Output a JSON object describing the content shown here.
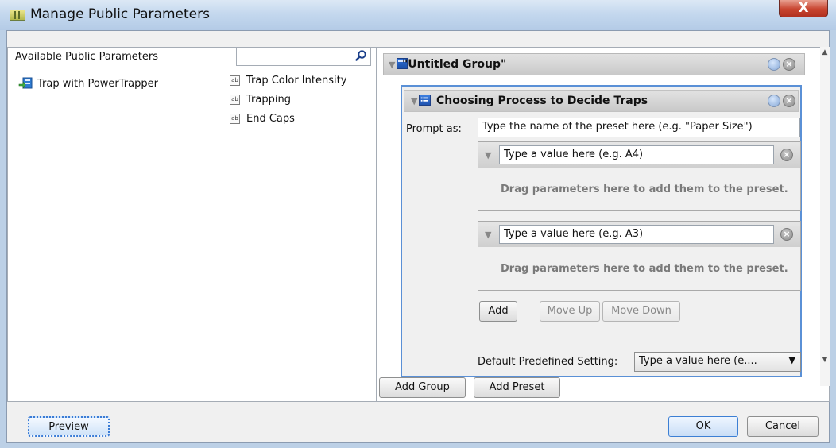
{
  "window": {
    "title": "Manage Public Parameters",
    "close_label": "X"
  },
  "left_panel": {
    "header": "Available Public Parameters",
    "search": {
      "value": "",
      "placeholder": ""
    },
    "templates": [
      {
        "label": "Trap with PowerTrapper"
      }
    ],
    "parameters": [
      {
        "label": "Trap Color Intensity"
      },
      {
        "label": "Trapping"
      },
      {
        "label": "End Caps"
      }
    ]
  },
  "group": {
    "title": "\"Untitled Group\"",
    "preset": {
      "title": "Choosing Process to Decide Traps",
      "prompt_label": "Prompt as:",
      "prompt_value": "Type the name of the preset here (e.g. \"Paper Size\")",
      "values": [
        {
          "input": "Type a value here (e.g. A4)",
          "hint": "Drag parameters here to add them to the preset."
        },
        {
          "input": "Type a value here (e.g. A3)",
          "hint": "Drag parameters here to add them to the preset."
        }
      ],
      "buttons": {
        "add": "Add",
        "move_up": "Move Up",
        "move_down": "Move Down"
      },
      "default_label": "Default Predefined Setting:",
      "default_value": "Type a value here (e...."
    }
  },
  "bottom_buttons": {
    "add_group": "Add Group",
    "add_preset": "Add Preset"
  },
  "footer": {
    "preview": "Preview",
    "ok": "OK",
    "cancel": "Cancel"
  },
  "colors": {
    "accent": "#5a90d6",
    "close": "#c8442f"
  }
}
